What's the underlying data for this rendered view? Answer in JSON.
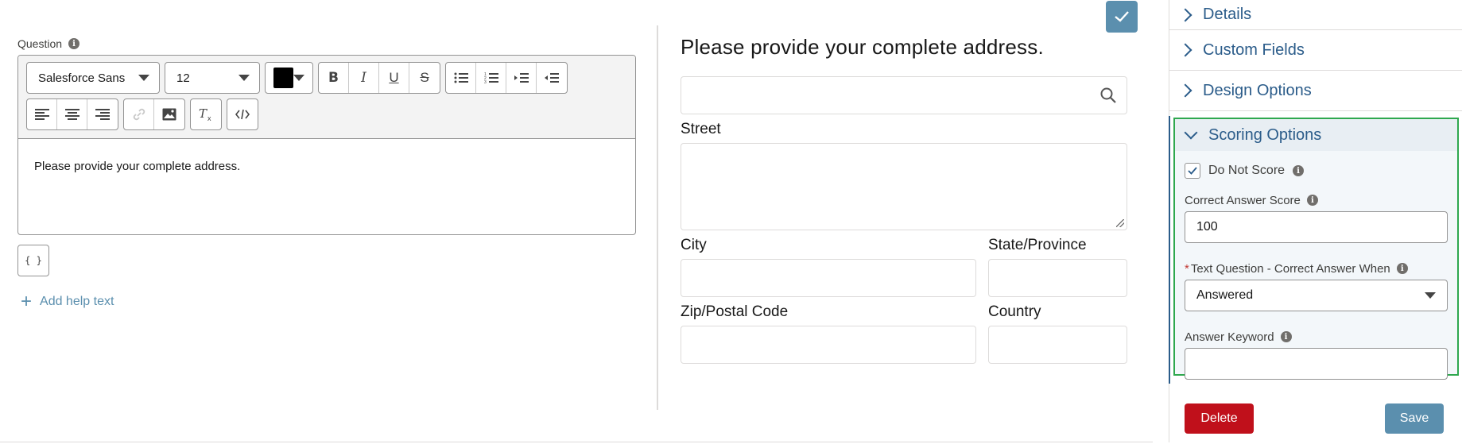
{
  "editor": {
    "question_label": "Question",
    "font_family": "Salesforce Sans",
    "font_size": "12",
    "text_color": "#000000",
    "body_text": "Please provide your complete address.",
    "merge_field_label": "{ }",
    "add_help_text": "Add help text"
  },
  "preview": {
    "title": "Please provide your complete address.",
    "street_label": "Street",
    "city_label": "City",
    "state_label": "State/Province",
    "zip_label": "Zip/Postal Code",
    "country_label": "Country"
  },
  "panel": {
    "sections": {
      "details": "Details",
      "custom_fields": "Custom Fields",
      "design_options": "Design Options",
      "scoring_options": "Scoring Options"
    },
    "scoring": {
      "do_not_score_label": "Do Not Score",
      "do_not_score_checked": true,
      "correct_answer_score_label": "Correct Answer Score",
      "correct_answer_score_value": "100",
      "correct_answer_when_label": "Text Question - Correct Answer When",
      "correct_answer_when_required": "*",
      "correct_answer_when_value": "Answered",
      "answer_keyword_label": "Answer Keyword",
      "answer_keyword_value": ""
    },
    "delete_label": "Delete",
    "save_label": "Save"
  },
  "colors": {
    "accent": "#5b8fae",
    "link": "#2b5c8a",
    "danger": "#c0101b",
    "highlight": "#2fa84f"
  }
}
